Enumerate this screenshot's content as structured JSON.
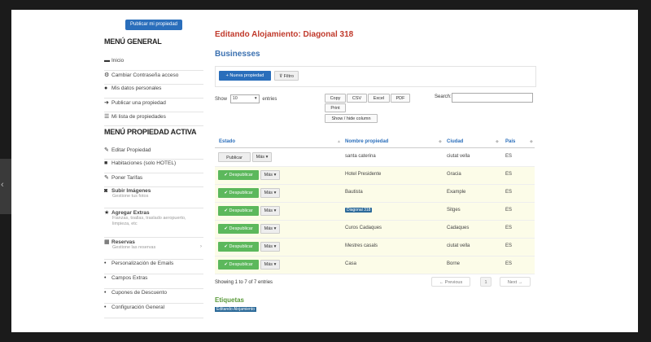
{
  "sidebar": {
    "publish_button": "Publicar mi propiedad",
    "general_title": "MENÚ GENERAL",
    "general_items": [
      {
        "label": "Inicio",
        "icon": "folder-icon"
      },
      {
        "label": "Cambiar Contraseña acceso",
        "icon": "gear-icon"
      },
      {
        "label": "Mis datos personales",
        "icon": "users-icon"
      },
      {
        "label": "Publicar una propiedad",
        "icon": "arrow-right-icon"
      },
      {
        "label": "Mi lista de propiedades",
        "icon": "list-icon"
      }
    ],
    "active_title": "MENÚ PROPIEDAD ACTIVA",
    "active_items": [
      {
        "label": "Editar Propiedad",
        "sub": "",
        "icon": "edit-icon"
      },
      {
        "label": "Habitaciones (solo HOTEL)",
        "sub": "",
        "icon": "briefcase-icon"
      },
      {
        "label": "Poner Tarifas",
        "sub": "",
        "icon": "pencil-icon"
      },
      {
        "label": "Subir Imágenes",
        "sub": "Gestione tus fotos",
        "icon": "camera-icon"
      },
      {
        "label": "Agregar Extras",
        "sub": "Fianzas, toallas, traslado aeropuerto, limpieza, etc",
        "icon": "star-icon"
      },
      {
        "label": "Reservas",
        "sub": "Gestione las reservas",
        "icon": "calendar-icon"
      },
      {
        "label": "Personalización de Emails",
        "sub": "",
        "icon": "dot-icon"
      },
      {
        "label": "Campos Extras",
        "sub": "",
        "icon": "dot-icon"
      },
      {
        "label": "Cupones de Descuento",
        "sub": "",
        "icon": "dot-icon"
      },
      {
        "label": "Configuración General",
        "sub": "",
        "icon": "dot-icon"
      }
    ]
  },
  "main": {
    "title": "Editando Alojamiento: Diagonal 318",
    "section": "Businesses",
    "new_button": "+ Nueva propiedad",
    "filter_button": "Filtro",
    "show_label": "Show",
    "show_value": "10",
    "entries_label": "entries",
    "export": {
      "copy": "Copy",
      "csv": "CSV",
      "excel": "Excel",
      "pdf": "PDF",
      "print": "Print",
      "colvis": "Show / hide column"
    },
    "search_label": "Search:",
    "columns": [
      "Estado",
      "Nombre propiedad",
      "Ciudad",
      "País"
    ],
    "rows": [
      {
        "action": "Publicar",
        "more": "Más",
        "name": "santa caterina",
        "city": "ciutat vella",
        "country": "ES",
        "published": false,
        "badge": false
      },
      {
        "action": "Despublicar",
        "more": "Más",
        "name": "Hotel Presidente",
        "city": "Gracia",
        "country": "ES",
        "published": true,
        "badge": false
      },
      {
        "action": "Despublicar",
        "more": "Más",
        "name": "Bautista",
        "city": "Example",
        "country": "ES",
        "published": true,
        "badge": false
      },
      {
        "action": "Despublicar",
        "more": "Más",
        "name": "Diagonal 318",
        "city": "Sitges",
        "country": "ES",
        "published": true,
        "badge": true
      },
      {
        "action": "Despublicar",
        "more": "Más",
        "name": "Curos Cadaques",
        "city": "Cadaques",
        "country": "ES",
        "published": true,
        "badge": false
      },
      {
        "action": "Despublicar",
        "more": "Más",
        "name": "Mestres casals",
        "city": "ciutat vella",
        "country": "ES",
        "published": true,
        "badge": false
      },
      {
        "action": "Despublicar",
        "more": "Más",
        "name": "Casa",
        "city": "Borne",
        "country": "ES",
        "published": true,
        "badge": false
      }
    ],
    "info": "Showing 1 to 7 of 7 entries",
    "pagination": {
      "prev": "← Previous",
      "page": "1",
      "next": "Next →"
    },
    "tags_title": "Etiquetas",
    "tag": "Editando Alojamiento"
  },
  "colors": {
    "accent": "#2a6ebb",
    "title": "#c0392b",
    "green": "#5cb85c",
    "tags": "#5a9a3a"
  }
}
